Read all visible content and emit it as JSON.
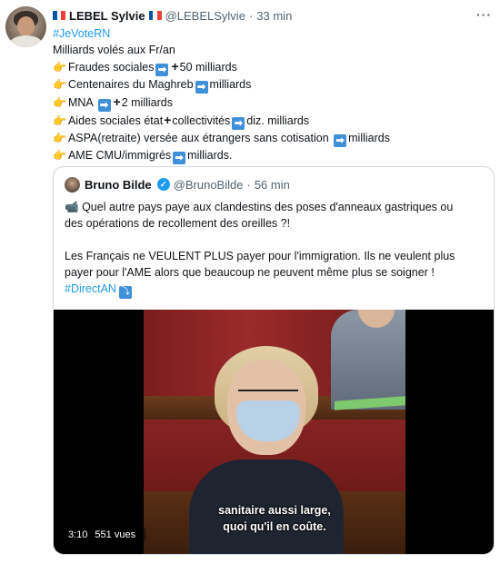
{
  "author": {
    "display_name": "LEBEL Sylvie",
    "handle": "@LEBELSylvie",
    "separator": "·",
    "time": "33 min"
  },
  "more_label": "···",
  "tweet_lines": [
    {
      "parts": [
        {
          "t": "text",
          "v": "#JeVoteRN"
        }
      ],
      "hashtag": true
    },
    {
      "parts": [
        {
          "t": "text",
          "v": "Milliards volés aux Fr/an"
        }
      ]
    },
    {
      "parts": [
        {
          "t": "emoji",
          "v": "👉"
        },
        {
          "t": "text",
          "v": "Fraudes sociales"
        },
        {
          "t": "arrow",
          "v": "➡"
        },
        {
          "t": "plus",
          "v": "+"
        },
        {
          "t": "text",
          "v": "50 milliards"
        }
      ]
    },
    {
      "parts": [
        {
          "t": "emoji",
          "v": "👉"
        },
        {
          "t": "text",
          "v": "Centenaires du Maghreb"
        },
        {
          "t": "arrow",
          "v": "➡"
        },
        {
          "t": "text",
          "v": "milliards"
        }
      ]
    },
    {
      "parts": [
        {
          "t": "emoji",
          "v": "👉"
        },
        {
          "t": "text",
          "v": "MNA "
        },
        {
          "t": "arrow",
          "v": "➡"
        },
        {
          "t": "plus",
          "v": "+"
        },
        {
          "t": "text",
          "v": "2 milliards"
        }
      ]
    },
    {
      "parts": [
        {
          "t": "emoji",
          "v": "👉"
        },
        {
          "t": "text",
          "v": "Aides sociales état"
        },
        {
          "t": "plus",
          "v": "+"
        },
        {
          "t": "text",
          "v": "collectivités"
        },
        {
          "t": "arrow",
          "v": "➡"
        },
        {
          "t": "text",
          "v": "diz. milliards"
        }
      ]
    },
    {
      "parts": [
        {
          "t": "emoji",
          "v": "👉"
        },
        {
          "t": "text",
          "v": "ASPA(retraite) versée aux étrangers sans cotisation "
        },
        {
          "t": "arrow",
          "v": "➡"
        },
        {
          "t": "text",
          "v": "milliards"
        }
      ]
    },
    {
      "parts": [
        {
          "t": "emoji",
          "v": "👉"
        },
        {
          "t": "text",
          "v": "AME CMU/immigrés"
        },
        {
          "t": "arrow",
          "v": "➡"
        },
        {
          "t": "text",
          "v": "milliards."
        }
      ]
    }
  ],
  "quoted": {
    "display_name": "Bruno Bilde",
    "handle": "@BrunoBilde",
    "separator": "·",
    "time": "56 min",
    "line1": "Quel autre pays paye aux clandestins des poses d'anneaux gastriques ou",
    "line2": "des opérations de recollement des oreilles ?!",
    "line3": "Les Français ne VEULENT PLUS payer pour l'immigration. Ils ne veulent plus",
    "line4": "payer pour l'AME alors que beaucoup ne peuvent même plus se soigner !",
    "line5": "#DirectAN",
    "camera_emoji": "📹",
    "enter_icon": "⤵",
    "video": {
      "subtitle_line1": "sanitaire aussi large,",
      "subtitle_line2": "quoi qu'il en coûte.",
      "duration": "3:10",
      "views": "551 vues"
    }
  },
  "flag_colors": [
    "#0055a4",
    "#ffffff",
    "#ef4135"
  ],
  "accent_color": "#1d9bf0",
  "verified_icon": "✓"
}
